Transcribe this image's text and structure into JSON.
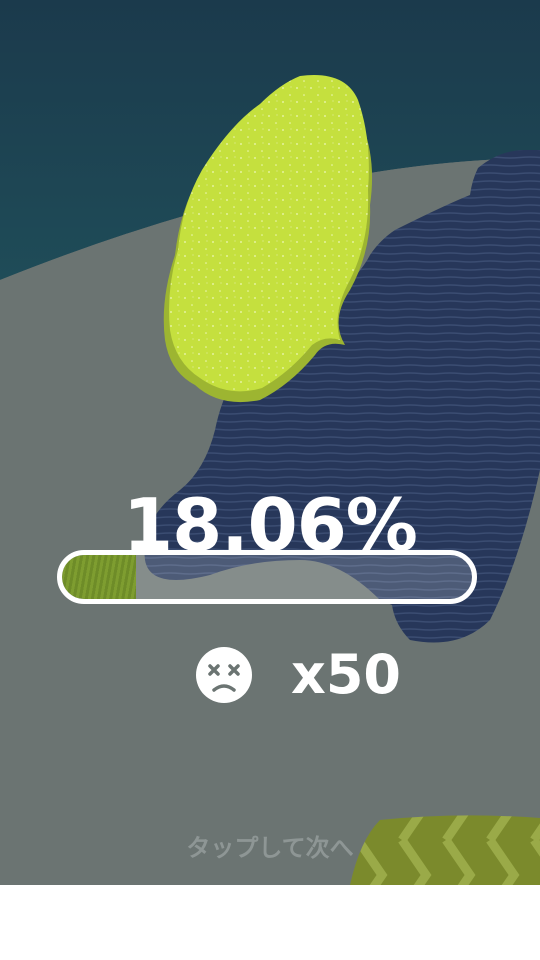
{
  "result": {
    "progress_label": "18.06%",
    "progress_value": 0.1806,
    "deaths_label": "x50",
    "deaths_icon": "dead-face-icon"
  },
  "prompt": {
    "tap_next": "タップして次へ"
  },
  "colors": {
    "sky": "#1c3d4d",
    "ground": "#6b7472",
    "player_blob": "#c5e03e",
    "level_shape": "#27375a",
    "progress_fill": "#7a9a2e",
    "text": "#ffffff"
  }
}
